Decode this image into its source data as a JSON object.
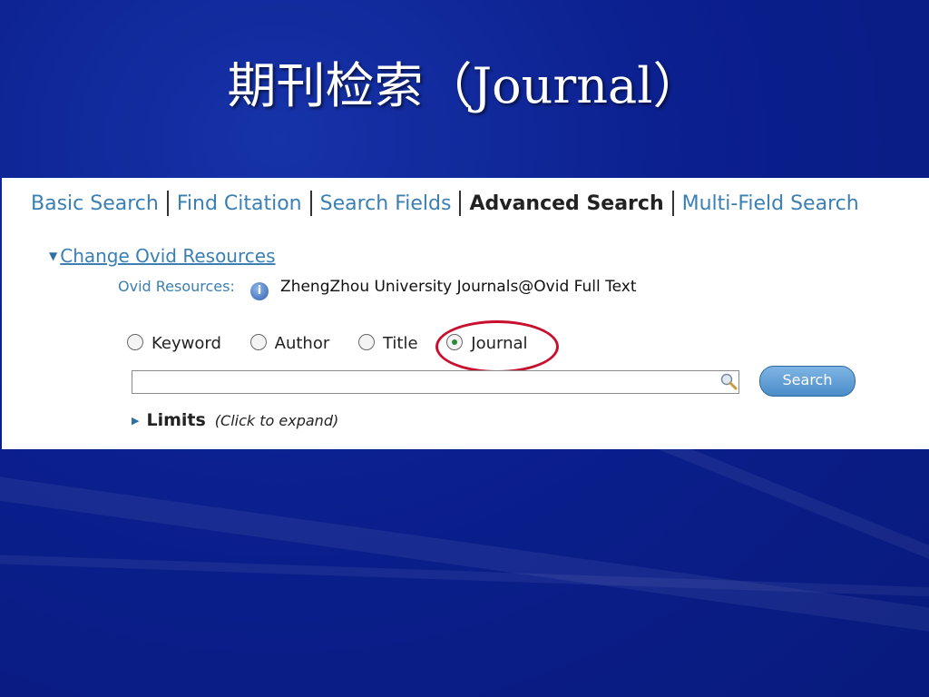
{
  "slide": {
    "title": "期刊检索（Journal）"
  },
  "tabs": [
    {
      "label": "Basic Search"
    },
    {
      "label": "Find Citation"
    },
    {
      "label": "Search Fields"
    },
    {
      "label": "Advanced Search"
    },
    {
      "label": "Multi-Field Search"
    }
  ],
  "resources": {
    "change_link": "Change Ovid Resources",
    "label": "Ovid Resources:",
    "value": "ZhengZhou University Journals@Ovid Full Text"
  },
  "search_types": [
    {
      "label": "Keyword",
      "checked": false
    },
    {
      "label": "Author",
      "checked": false
    },
    {
      "label": "Title",
      "checked": false
    },
    {
      "label": "Journal",
      "checked": true
    }
  ],
  "search": {
    "input_value": "",
    "button_label": "Search"
  },
  "limits": {
    "label": "Limits",
    "hint": "(Click to expand)"
  },
  "colors": {
    "background": "#0b1f8e",
    "link": "#3b7fb3",
    "highlight_ring": "#c8102e"
  }
}
